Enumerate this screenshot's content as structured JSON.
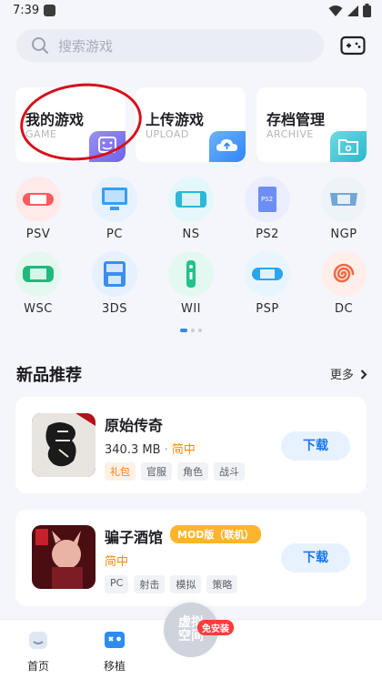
{
  "status_bar": {
    "time": "7:39"
  },
  "search": {
    "placeholder": "搜索游戏"
  },
  "quick_cards": [
    {
      "title": "我的游戏",
      "subtitle": "GAME",
      "color": "#6e63e8"
    },
    {
      "title": "上传游戏",
      "subtitle": "UPLOAD",
      "color": "#2f86f6"
    },
    {
      "title": "存档管理",
      "subtitle": "ARCHIVE",
      "color": "#27b9c9"
    }
  ],
  "platforms": [
    {
      "label": "PSV",
      "icon": "psv-console-icon",
      "bg": "#ffe9e9",
      "fg": "#ff5a5f"
    },
    {
      "label": "PC",
      "icon": "pc-monitor-icon",
      "bg": "#e6f2ff",
      "fg": "#3a9cf5"
    },
    {
      "label": "NS",
      "icon": "switch-console-icon",
      "bg": "#e4f7fb",
      "fg": "#2cb8d6"
    },
    {
      "label": "PS2",
      "icon": "ps2-console-icon",
      "bg": "#eaeefe",
      "fg": "#6c8ef5"
    },
    {
      "label": "NGP",
      "icon": "ngp-console-icon",
      "bg": "#eef3f8",
      "fg": "#6fa7d8"
    },
    {
      "label": "WSC",
      "icon": "wsc-console-icon",
      "bg": "#e4f8ef",
      "fg": "#20b97d"
    },
    {
      "label": "3DS",
      "icon": "3ds-console-icon",
      "bg": "#e6f1ff",
      "fg": "#3d8cf0"
    },
    {
      "label": "WII",
      "icon": "wii-remote-icon",
      "bg": "#e4f8f2",
      "fg": "#21c28c"
    },
    {
      "label": "PSP",
      "icon": "psp-console-icon",
      "bg": "#e8f5fe",
      "fg": "#2aa5ef"
    },
    {
      "label": "DC",
      "icon": "dreamcast-swirl-icon",
      "bg": "#ffeeea",
      "fg": "#f26a45"
    }
  ],
  "section": {
    "title": "新品推荐",
    "more": "更多"
  },
  "games": [
    {
      "name": "原始传奇",
      "size": "340.3 MB",
      "separator": "·",
      "lang": "简中",
      "tags": [
        "礼包",
        "官服",
        "角色",
        "战斗"
      ],
      "download": "下载"
    },
    {
      "name": "骗子酒馆",
      "badge": "MOD版（联机）",
      "lang": "简中",
      "tags": [
        "PC",
        "射击",
        "模拟",
        "策略"
      ],
      "download": "下载"
    }
  ],
  "bottom_nav": {
    "home": "首页",
    "port": "移植",
    "fab": "虚拟空间",
    "fab_badge": "免安装"
  }
}
